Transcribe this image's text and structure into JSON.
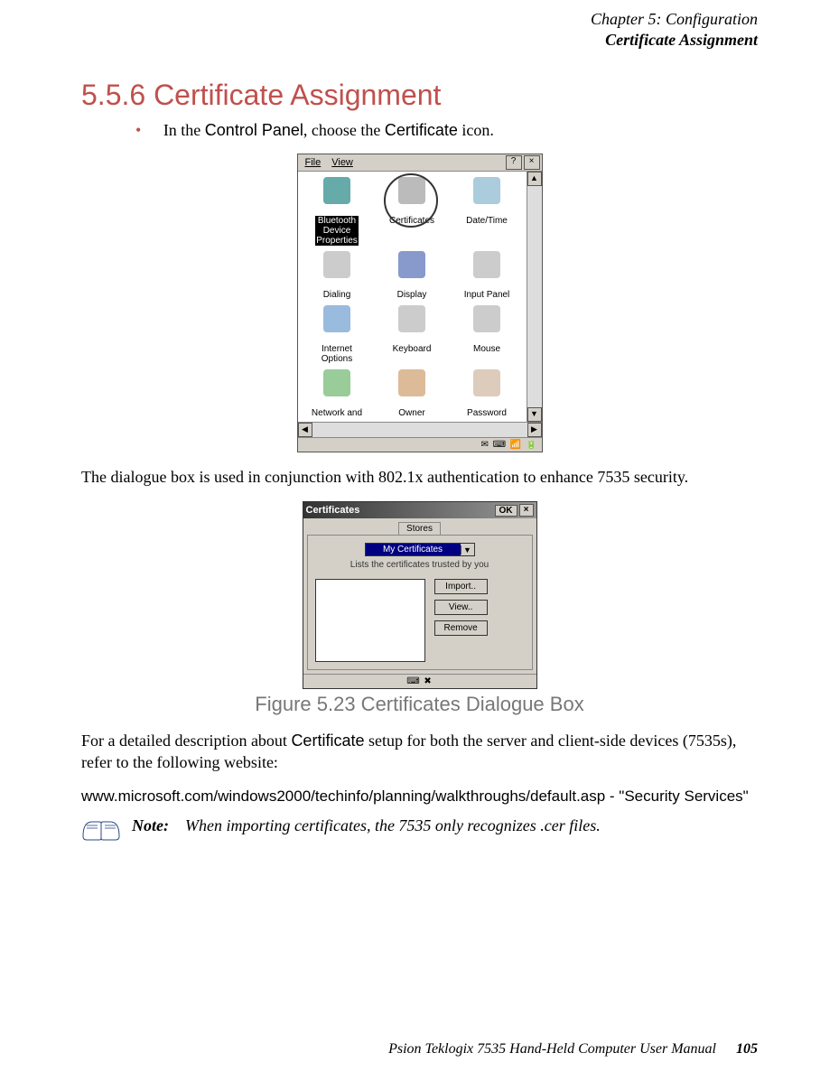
{
  "header": {
    "line1": "Chapter 5: Configuration",
    "line2": "Certificate Assignment"
  },
  "heading": "5.5.6  Certificate Assignment",
  "bullet": {
    "pre": "In the ",
    "cp": "Control Panel",
    "mid": ", choose the ",
    "cert": "Certificate",
    "post": " icon."
  },
  "cp_window": {
    "menu_file": "File",
    "menu_view": "View",
    "help_btn": "?",
    "close_btn": "×",
    "icons": [
      {
        "label": "Bluetooth\nDevice\nProperties",
        "name": "bluetooth-icon",
        "selected": true
      },
      {
        "label": "Certificates",
        "name": "certificates-icon",
        "circled": true
      },
      {
        "label": "Date/Time",
        "name": "datetime-icon"
      },
      {
        "label": "Dialing",
        "name": "dialing-icon"
      },
      {
        "label": "Display",
        "name": "display-icon"
      },
      {
        "label": "Input Panel",
        "name": "input-panel-icon"
      },
      {
        "label": "Internet\nOptions",
        "name": "internet-options-icon"
      },
      {
        "label": "Keyboard",
        "name": "keyboard-icon"
      },
      {
        "label": "Mouse",
        "name": "mouse-icon"
      },
      {
        "label": "Network and",
        "name": "network-icon"
      },
      {
        "label": "Owner",
        "name": "owner-icon"
      },
      {
        "label": "Password",
        "name": "password-icon"
      }
    ]
  },
  "para1": "The dialogue box is used in conjunction with 802.1x authentication to enhance 7535 security.",
  "cert_dialog": {
    "title": "Certificates",
    "ok": "OK",
    "close": "×",
    "tab": "Stores",
    "select_value": "My Certificates",
    "help_text": "Lists the certificates trusted by you",
    "buttons": [
      "Import..",
      "View..",
      "Remove"
    ]
  },
  "figure_caption": "Figure 5.23 Certificates Dialogue Box",
  "para2_pre": "For a detailed description about ",
  "para2_cert": "Certificate",
  "para2_post": " setup for both the server and client-side devices (7535s), refer to the following website:",
  "link": "www.microsoft.com/windows2000/techinfo/planning/walkthroughs/default.asp - \"Security Services\"",
  "note_label": "Note:",
  "note_text": "When importing certificates, the 7535 only recognizes .cer files.",
  "footer": {
    "text": "Psion Teklogix 7535 Hand-Held Computer User Manual",
    "page": "105"
  }
}
